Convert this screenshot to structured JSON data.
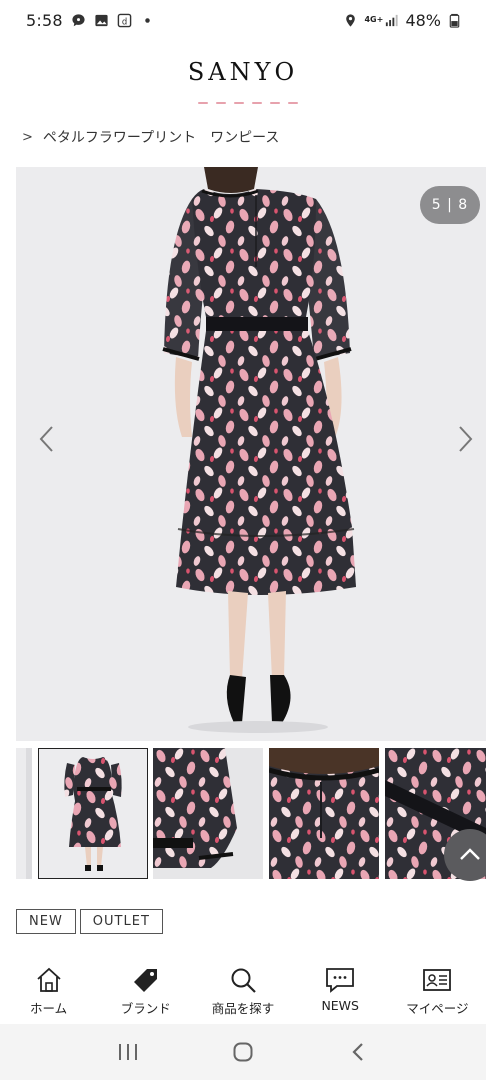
{
  "status_bar": {
    "time": "5:58",
    "battery": "48%",
    "network_label": "4G+",
    "icons": [
      "chat-bubble-icon",
      "gallery-icon",
      "d-app-icon",
      "dot-icon",
      "location-icon",
      "signal-icon",
      "battery-icon"
    ]
  },
  "header": {
    "logo": "SANYO"
  },
  "breadcrumb": {
    "arrow": ">",
    "item": "ペタルフラワープリント　ワンピース"
  },
  "gallery": {
    "counter": "5 | 8",
    "current": 5,
    "total": 8,
    "prev_icon": "chevron-left-icon",
    "next_icon": "chevron-right-icon",
    "dress_colors": {
      "base": "#2f2f36",
      "petal_pink": "#e9a6b4",
      "petal_light": "#f4e0e3",
      "petal_red": "#d9546f",
      "background": "#ececee"
    }
  },
  "thumbnails": [
    {
      "label": "partial",
      "selected": false
    },
    {
      "label": "full",
      "selected": true
    },
    {
      "label": "sleeve",
      "selected": false
    },
    {
      "label": "back-neck",
      "selected": false
    },
    {
      "label": "belt",
      "selected": false
    }
  ],
  "tags": [
    "NEW",
    "OUTLET"
  ],
  "bottom_nav": [
    {
      "label": "ホーム",
      "icon": "home-icon"
    },
    {
      "label": "ブランド",
      "icon": "tag-icon"
    },
    {
      "label": "商品を探す",
      "icon": "search-icon"
    },
    {
      "label": "NEWS",
      "icon": "news-icon"
    },
    {
      "label": "マイページ",
      "icon": "id-card-icon"
    }
  ],
  "system_nav": [
    "recent-apps-icon",
    "home-circle-icon",
    "back-icon"
  ]
}
